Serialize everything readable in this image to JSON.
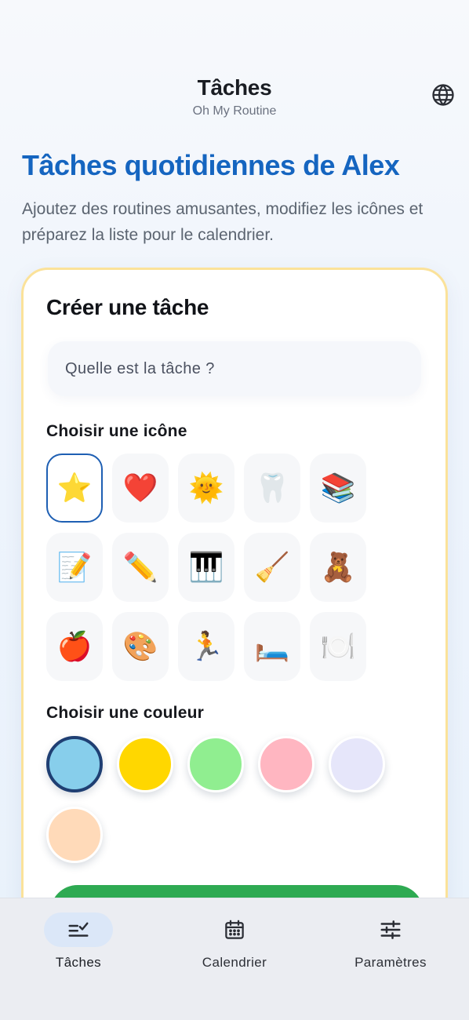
{
  "header": {
    "title": "Tâches",
    "subtitle": "Oh My Routine",
    "globe_icon": "globe-icon"
  },
  "page": {
    "title": "Tâches quotidiennes de Alex",
    "description": "Ajoutez des routines amusantes, modifiez les icônes et préparez la liste pour le calendrier."
  },
  "form": {
    "title": "Créer une tâche",
    "task_input": {
      "value": "",
      "placeholder": "Quelle est la tâche ?"
    },
    "icon_label": "Choisir une icône",
    "icons": [
      "⭐",
      "❤️",
      "🌞",
      "🦷",
      "📚",
      "📝",
      "✏️",
      "🎹",
      "🧹",
      "🧸",
      "🍎",
      "🎨",
      "🏃",
      "🛏️",
      "🍽️"
    ],
    "selected_icon": "⭐",
    "color_label": "Choisir une couleur",
    "colors": [
      "#87ceeb",
      "#ffd700",
      "#90ee90",
      "#ffb6c1",
      "#e6e6fa",
      "#ffdab9"
    ],
    "selected_color": "#87ceeb",
    "accent_color": "#1565c0",
    "add_button_color": "#2eaa52"
  },
  "tabbar": {
    "tabs": [
      {
        "label": "Tâches",
        "icon": "task-list-check-icon",
        "active": true
      },
      {
        "label": "Calendrier",
        "icon": "calendar-icon",
        "active": false
      },
      {
        "label": "Paramètres",
        "icon": "sliders-icon",
        "active": false
      }
    ]
  }
}
